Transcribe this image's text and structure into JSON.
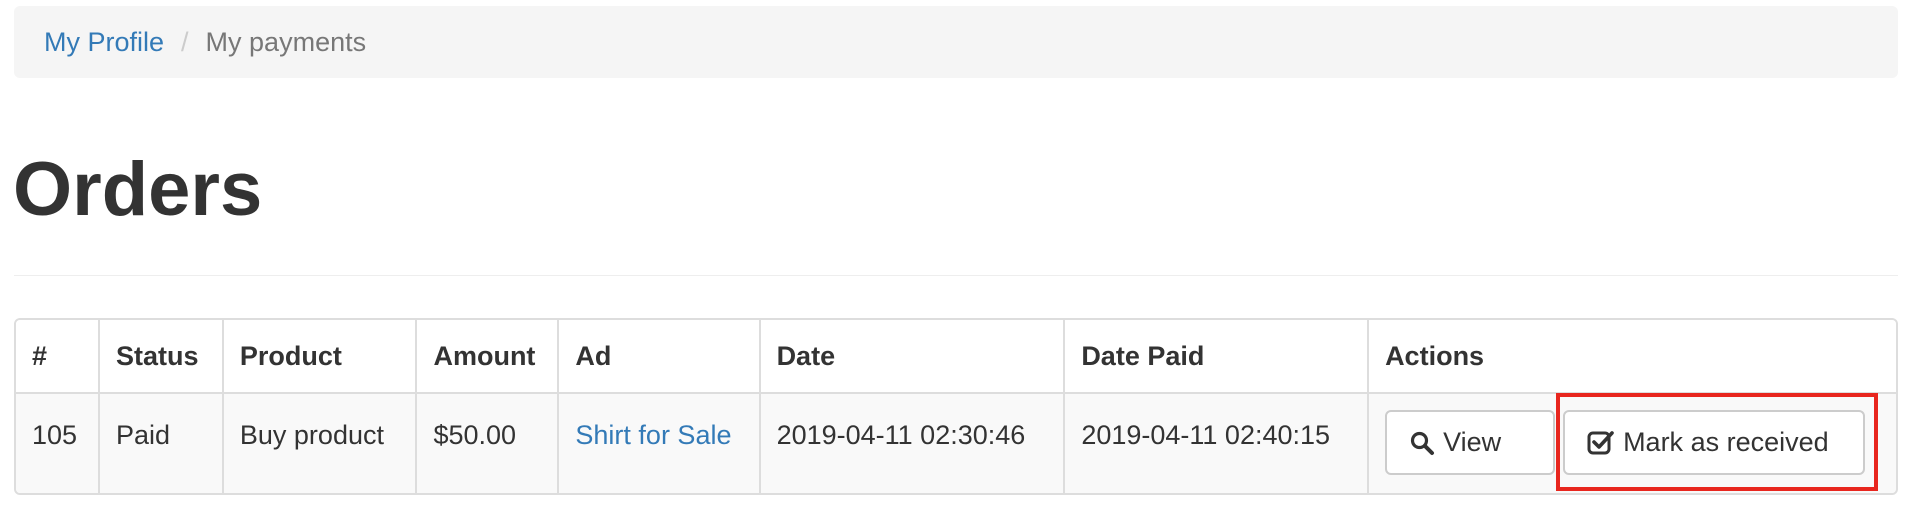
{
  "breadcrumb": {
    "items": [
      {
        "label": "My Profile"
      },
      {
        "label": "My payments"
      }
    ],
    "separator": "/"
  },
  "page": {
    "title": "Orders"
  },
  "orders_table": {
    "headers": [
      "#",
      "Status",
      "Product",
      "Amount",
      "Ad",
      "Date",
      "Date Paid",
      "Actions"
    ],
    "rows": [
      {
        "id": "105",
        "status": "Paid",
        "product": "Buy product",
        "amount": "$50.00",
        "ad": "Shirt for Sale",
        "date": "2019-04-11 02:30:46",
        "date_paid": "2019-04-11 02:40:15",
        "actions": {
          "view_label": "View",
          "view_icon": "search-icon",
          "mark_received_label": "Mark as received",
          "mark_received_icon": "check-square-icon"
        }
      }
    ]
  },
  "colors": {
    "link": "#337ab7",
    "highlight": "#e8261e",
    "breadcrumb_bg": "#f5f5f5",
    "row_bg": "#f9f9f9"
  }
}
